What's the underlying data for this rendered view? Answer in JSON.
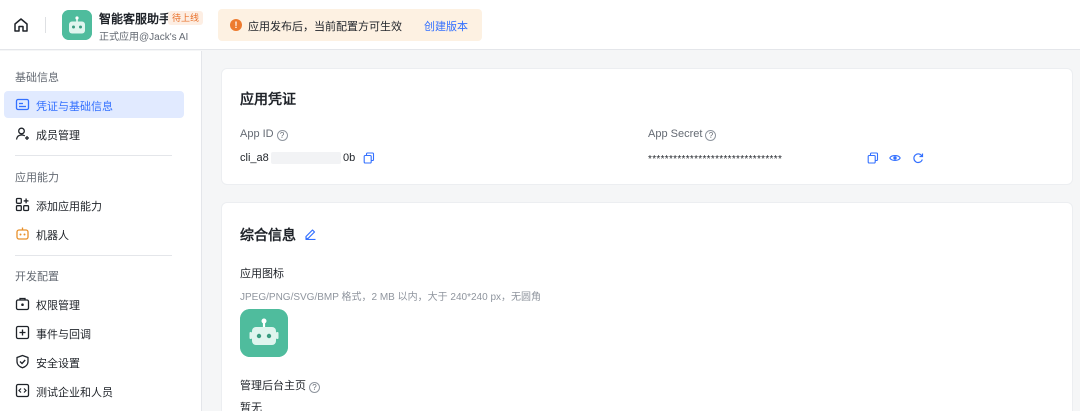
{
  "app": {
    "name": "智能客服助手",
    "badge": "待上线",
    "subtitle": "正式应用@Jack's AI"
  },
  "notice": {
    "text": "应用发布后，当前配置方可生效",
    "link": "创建版本"
  },
  "sidebar": {
    "sections": [
      {
        "title": "基础信息",
        "items": [
          {
            "label": "凭证与基础信息",
            "active": true
          },
          {
            "label": "成员管理"
          }
        ]
      },
      {
        "title": "应用能力",
        "items": [
          {
            "label": "添加应用能力"
          },
          {
            "label": "机器人"
          }
        ]
      },
      {
        "title": "开发配置",
        "items": [
          {
            "label": "权限管理"
          },
          {
            "label": "事件与回调"
          },
          {
            "label": "安全设置"
          },
          {
            "label": "测试企业和人员"
          }
        ]
      }
    ]
  },
  "credentials": {
    "title": "应用凭证",
    "app_id_label": "App ID",
    "app_id_prefix": "cli_a8",
    "app_id_suffix": "0b",
    "app_secret_label": "App Secret",
    "app_secret_value": "********************************"
  },
  "general": {
    "title": "综合信息",
    "icon_label": "应用图标",
    "icon_hint": "JPEG/PNG/SVG/BMP 格式，2 MB 以内，大于 240*240 px，无圆角",
    "homepage_label": "管理后台主页",
    "homepage_value": "暂无"
  },
  "colors": {
    "accent": "#3370ff",
    "app_icon": "#4fbc9d",
    "notice_bg": "#fdf1e2",
    "warning": "#ed7b2f"
  }
}
